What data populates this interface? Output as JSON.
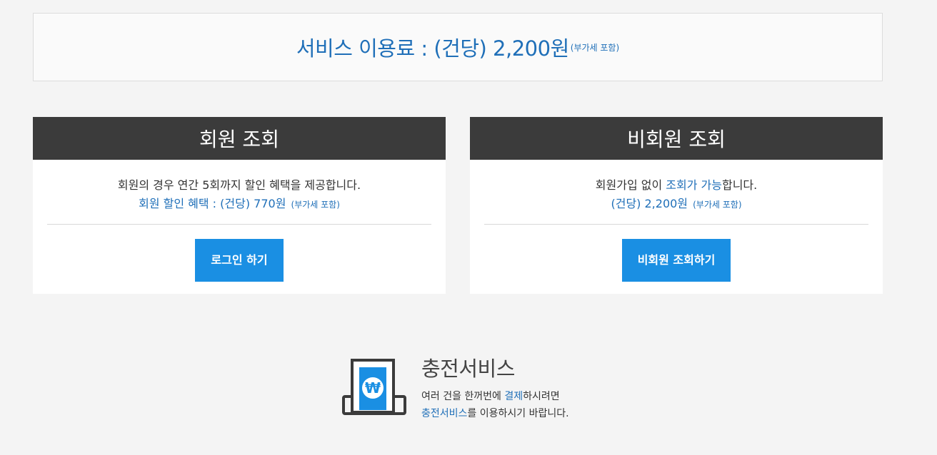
{
  "fee": {
    "main": "서비스 이용료 : (건당) 2,200원",
    "note": "(부가세 포함)"
  },
  "member": {
    "title": "회원 조회",
    "desc": "회원의 경우 연간 5회까지 할인 혜택을 제공합니다.",
    "discount": "회원 할인 혜택 : (건당) 770원",
    "discount_note": "(부가세 포함)",
    "button": "로그인 하기"
  },
  "guest": {
    "title": "비회원 조회",
    "desc_pre": "회원가입 없이 ",
    "desc_hl": "조회가 가능",
    "desc_post": "합니다.",
    "price": "(건당) 2,200원",
    "price_note": "(부가세 포함)",
    "button": "비회원 조회하기"
  },
  "charge": {
    "icon": "won-receipt-icon",
    "icon_glyph": "₩",
    "title": "충전서비스",
    "line1_pre": "여러 건을 한꺼번에 ",
    "line1_hl": "결제",
    "line1_post": "하시려면",
    "line2_hl": "충전서비스",
    "line2_post": "를 이용하시기 바랍니다."
  },
  "colors": {
    "accent": "#1f6fb8",
    "button": "#1a8fe3",
    "header": "#3b3b3b"
  }
}
